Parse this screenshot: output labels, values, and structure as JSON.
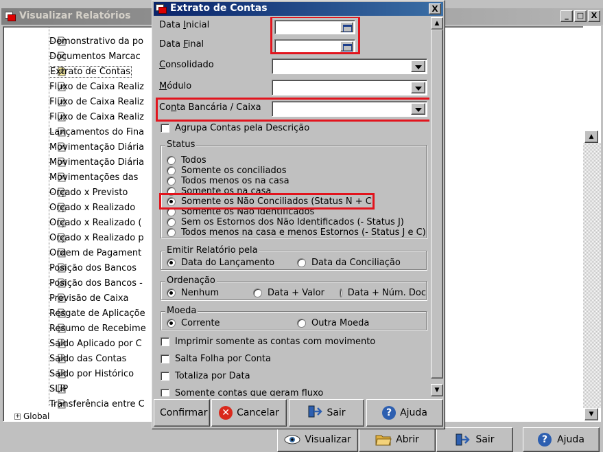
{
  "background_window": {
    "title": "Visualizar Relatórios",
    "controls": [
      "_",
      "□",
      "X"
    ],
    "tree_items": [
      "Demonstrativo da po",
      "Documentos Marcac",
      "Extrato de Contas",
      "Fluxo de Caixa Realiz",
      "Fluxo de Caixa Realiz",
      "Fluxo de Caixa Realiz",
      "Lançamentos do Fina",
      "Movimentação Diária",
      "Movimentação Diária",
      "Movimentações das",
      "Orçado x Previsto",
      "Orçado x Realizado",
      "Orçado x Realizado (",
      "Orçado x Realizado p",
      "Ordem de Pagament",
      "Posição dos Bancos",
      "Posição dos Bancos -",
      "Previsão de Caixa",
      "Resgate de Aplicaçõe",
      "Resumo de Recebime",
      "Saldo Aplicado por C",
      "Saldo das Contas",
      "Saldo por Histórico",
      "SLIP",
      "Transferência entre C"
    ],
    "selected_index": 2,
    "tree_root": "Global",
    "buttons": {
      "visualizar": "Visualizar",
      "abrir": "Abrir",
      "sair": "Sair",
      "ajuda": "Ajuda"
    }
  },
  "dialog": {
    "title": "Extrato de Contas",
    "close": "X",
    "fields": {
      "data_inicial": {
        "label": "Data Inicial",
        "value": ""
      },
      "data_final": {
        "label": "Data Final",
        "value": ""
      },
      "consolidado": {
        "label": "Consolidado",
        "value": ""
      },
      "modulo": {
        "label": "Módulo",
        "value": ""
      },
      "conta_bancaria": {
        "label": "Conta Bancária / Caixa",
        "value": ""
      }
    },
    "agrupa_contas": {
      "label": "Agrupa Contas pela Descrição",
      "checked": false
    },
    "status": {
      "legend": "Status",
      "options": [
        "Todos",
        "Somente os conciliados",
        "Todos menos os na casa",
        "Somente os na casa",
        "Somente os Não Conciliados (Status N + C)",
        "Somente os Não Identificados",
        "Sem os Estornos dos Não Identificados (- Status J)",
        "Todos menos na casa e menos Estornos (- Status J e C)"
      ],
      "selected": 4
    },
    "emitir": {
      "legend": "Emitir Relatório pela",
      "options": [
        "Data do Lançamento",
        "Data da Conciliação"
      ],
      "selected": 0
    },
    "ordenacao": {
      "legend": "Ordenação",
      "options": [
        "Nenhum",
        "Data + Valor",
        "Data + Núm. Doc"
      ],
      "selected": 0
    },
    "moeda": {
      "legend": "Moeda",
      "options": [
        "Corrente",
        "Outra Moeda"
      ],
      "selected": 0
    },
    "checkboxes": [
      {
        "label": "Imprimir somente as contas com movimento",
        "checked": false
      },
      {
        "label": "Salta Folha por Conta",
        "checked": false
      },
      {
        "label": "Totaliza por Data",
        "checked": false
      },
      {
        "label": "Somente contas que geram fluxo",
        "checked": false
      }
    ],
    "buttons": {
      "confirmar": "Confirmar",
      "cancelar": "Cancelar",
      "sair": "Sair",
      "ajuda": "Ajuda"
    },
    "highlight_color": "#e2141d"
  }
}
